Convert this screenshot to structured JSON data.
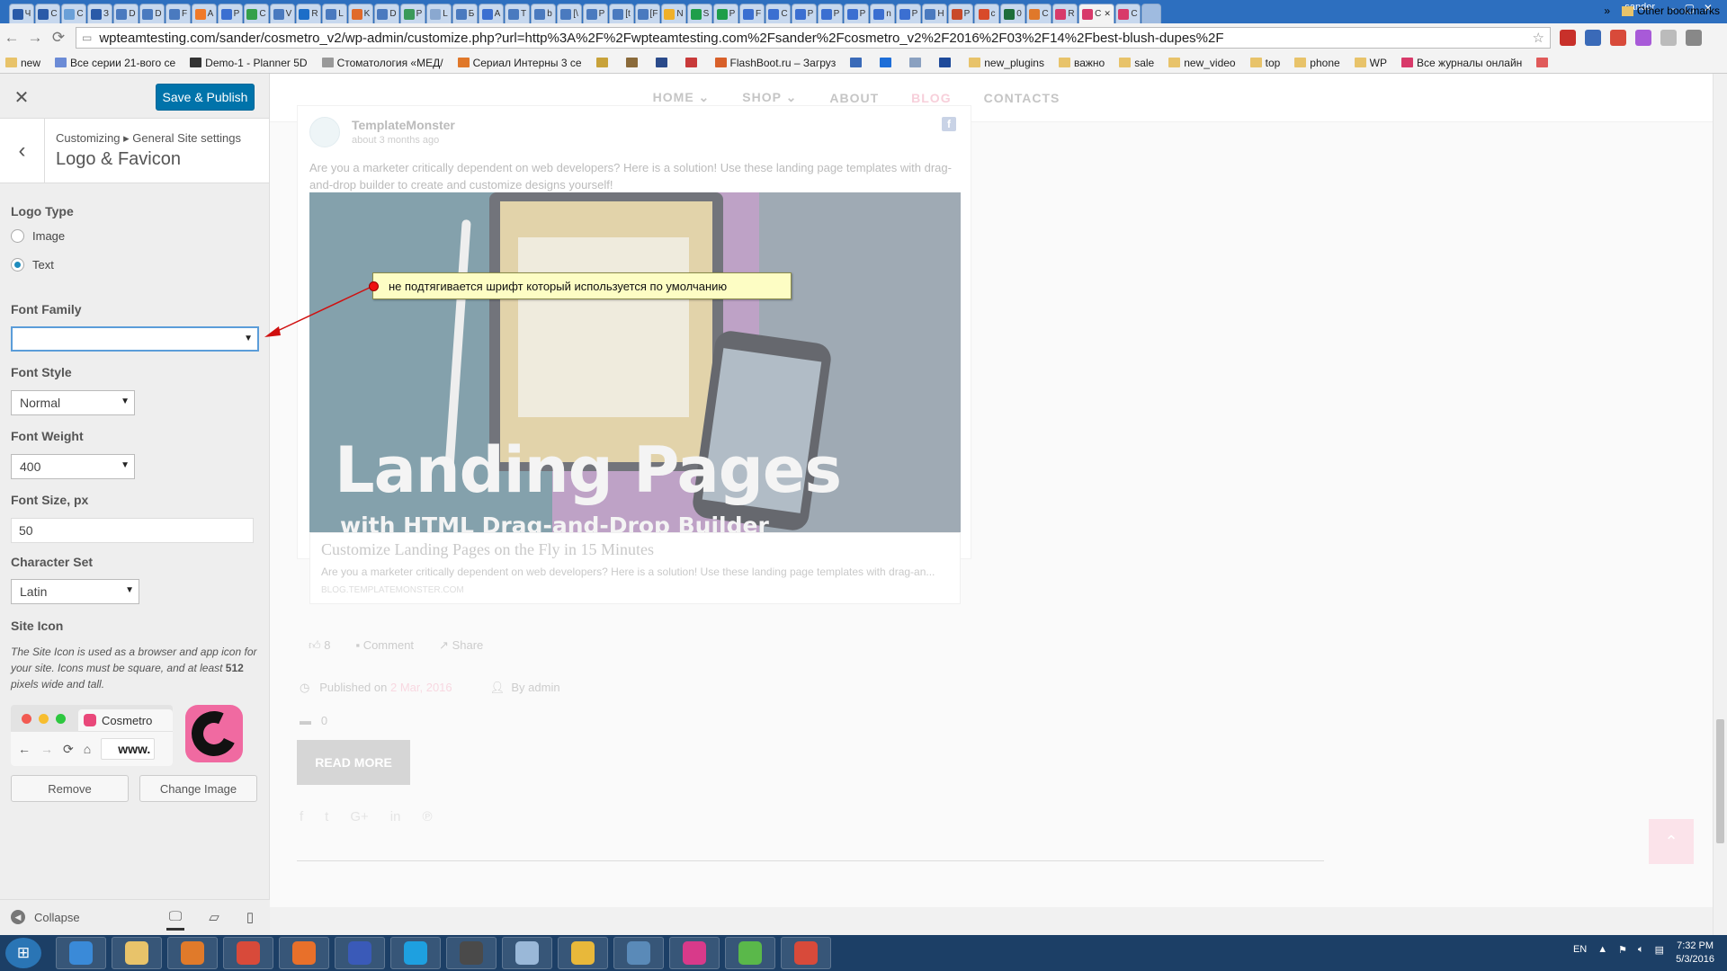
{
  "browser": {
    "tabs": [
      {
        "label": "Ч",
        "color": "#2a5aa8"
      },
      {
        "label": "С",
        "color": "#2a5aa8"
      },
      {
        "label": "С",
        "color": "#6aa0d8"
      },
      {
        "label": "З",
        "color": "#2a5aa8"
      },
      {
        "label": "D",
        "color": "#4a7abf"
      },
      {
        "label": "D",
        "color": "#4a7abf"
      },
      {
        "label": "F",
        "color": "#4a7abf"
      },
      {
        "label": "A",
        "color": "#f07a2a"
      },
      {
        "label": "P",
        "color": "#3b6fd1"
      },
      {
        "label": "C",
        "color": "#35a04a"
      },
      {
        "label": "V",
        "color": "#4a7abf"
      },
      {
        "label": "R",
        "color": "#1c6ec8"
      },
      {
        "label": "L",
        "color": "#4a7abf"
      },
      {
        "label": "K",
        "color": "#e06a2a"
      },
      {
        "label": "D",
        "color": "#4a7abf"
      },
      {
        "label": "P",
        "color": "#3a9a5a"
      },
      {
        "label": "L",
        "color": "#8aa8d0"
      },
      {
        "label": "Б",
        "color": "#4a7abf"
      },
      {
        "label": "A",
        "color": "#3b6fd1"
      },
      {
        "label": "T",
        "color": "#4a7abf"
      },
      {
        "label": "b",
        "color": "#4a7abf"
      },
      {
        "label": "[\\",
        "color": "#4a7abf"
      },
      {
        "label": "P",
        "color": "#4a7abf"
      },
      {
        "label": "[t",
        "color": "#4a7abf"
      },
      {
        "label": "[F",
        "color": "#4a7abf"
      },
      {
        "label": "N",
        "color": "#f0b02a"
      },
      {
        "label": "S",
        "color": "#1e9e4a"
      },
      {
        "label": "P",
        "color": "#1e9e4a"
      },
      {
        "label": "F",
        "color": "#3b6fd1"
      },
      {
        "label": "C",
        "color": "#3b6fd1"
      },
      {
        "label": "P",
        "color": "#3b6fd1"
      },
      {
        "label": "P",
        "color": "#3b6fd1"
      },
      {
        "label": "P",
        "color": "#3b6fd1"
      },
      {
        "label": "n",
        "color": "#3b6fd1"
      },
      {
        "label": "P",
        "color": "#3b6fd1"
      },
      {
        "label": "H",
        "color": "#4a7abf"
      },
      {
        "label": "P",
        "color": "#c84a2a"
      },
      {
        "label": "c",
        "color": "#d84a2a"
      },
      {
        "label": "0",
        "color": "#1e6e3a"
      },
      {
        "label": "C",
        "color": "#e0782a"
      },
      {
        "label": "R",
        "color": "#d83a6a"
      },
      {
        "label": "C",
        "color": "#d83a6a",
        "active": true
      },
      {
        "label": "C",
        "color": "#d83a6a"
      }
    ],
    "user": "sander",
    "url": "wpteamtesting.com/sander/cosmetro_v2/wp-admin/customize.php?url=http%3A%2F%2Fwpteamtesting.com%2Fsander%2Fcosmetro_v2%2F2016%2F03%2F14%2Fbest-blush-dupes%2F",
    "bookmarks": [
      {
        "label": "new",
        "type": "folder"
      },
      {
        "label": "Все серии 21-вого се",
        "type": "site",
        "color": "#6b8bd6"
      },
      {
        "label": "Demo-1 - Planner 5D",
        "type": "site",
        "color": "#333333"
      },
      {
        "label": "Стоматология «МЕД/",
        "type": "site",
        "color": "#999999"
      },
      {
        "label": "Сериал Интерны 3 се",
        "type": "site",
        "color": "#e0782a"
      },
      {
        "label": "",
        "type": "site",
        "color": "#c8a23a"
      },
      {
        "label": "",
        "type": "site",
        "color": "#8a6a3a"
      },
      {
        "label": "",
        "type": "site",
        "color": "#2a4a8a"
      },
      {
        "label": "",
        "type": "site",
        "color": "#c83a3a"
      },
      {
        "label": "FlashBoot.ru – Загруз",
        "type": "site",
        "color": "#d8602a"
      },
      {
        "label": "",
        "type": "site",
        "color": "#3a6ab8"
      },
      {
        "label": "",
        "type": "site",
        "color": "#1e6ed8"
      },
      {
        "label": "",
        "type": "site",
        "color": "#8aa0c0"
      },
      {
        "label": "",
        "type": "site",
        "color": "#1e4a9a"
      },
      {
        "label": "new_plugins",
        "type": "folder"
      },
      {
        "label": "важно",
        "type": "folder"
      },
      {
        "label": "sale",
        "type": "folder"
      },
      {
        "label": "new_video",
        "type": "folder"
      },
      {
        "label": "top",
        "type": "folder"
      },
      {
        "label": "phone",
        "type": "folder"
      },
      {
        "label": "WP",
        "type": "folder"
      },
      {
        "label": "Все журналы онлайн",
        "type": "site",
        "color": "#d83a6a"
      },
      {
        "label": "",
        "type": "site",
        "color": "#e05a5a"
      }
    ],
    "bookmarks_more": "»",
    "other_bookmarks": "Other bookmarks"
  },
  "customizer": {
    "close_glyph": "✕",
    "save_label": "Save & Publish",
    "back_glyph": "‹",
    "breadcrumb": "Customizing ▸ General Site settings",
    "section_title": "Logo & Favicon",
    "logo_type_label": "Logo Type",
    "logo_type_options": [
      {
        "label": "Image",
        "selected": false
      },
      {
        "label": "Text",
        "selected": true
      }
    ],
    "font_family_label": "Font Family",
    "font_family_value": "",
    "font_style_label": "Font Style",
    "font_style_value": "Normal",
    "font_weight_label": "Font Weight",
    "font_weight_value": "400",
    "font_size_label": "Font Size, px",
    "font_size_value": "50",
    "charset_label": "Character Set",
    "charset_value": "Latin",
    "site_icon_label": "Site Icon",
    "site_icon_desc_1": "The Site Icon is used as a browser and app icon for your site. Icons must be square, and at least ",
    "site_icon_desc_bold": "512",
    "site_icon_desc_2": " pixels wide and tall.",
    "preview_tab_title": "Cosmetro",
    "preview_url": "www.",
    "remove_label": "Remove",
    "change_image_label": "Change Image",
    "collapse_label": "Collapse",
    "select_arrow": "▼"
  },
  "annotation": {
    "text": "не подтягивается шрифт который используется по умолчанию"
  },
  "site": {
    "nav": [
      {
        "label": "HOME",
        "caret": true
      },
      {
        "label": "SHOP",
        "caret": true
      },
      {
        "label": "ABOUT",
        "caret": false
      },
      {
        "label": "BLOG",
        "caret": false,
        "active": true
      },
      {
        "label": "CONTACTS",
        "caret": false
      }
    ],
    "post": {
      "author": "TemplateMonster",
      "date": "about 3 months ago",
      "intro": "Are you a marketer critically dependent on web developers? Here is a solution! Use these landing page templates with drag-and-drop builder to create and customize designs yourself!",
      "image_title": "Landing Pages",
      "image_subtitle": "with HTML Drag-and-Drop Builder",
      "link_title": "Customize Landing Pages on the Fly in 15 Minutes",
      "link_desc": "Are you a marketer critically dependent on web developers? Here is a solution! Use these landing page templates with drag-an...",
      "link_domain": "BLOG.TEMPLATEMONSTER.COM",
      "likes": "8",
      "comment_label": "Comment",
      "share_label": "Share",
      "published_prefix": "Published on",
      "published_date": "2 Mar, 2016",
      "by_label": "By admin",
      "comments_count": "0",
      "read_more": "READ MORE"
    }
  },
  "taskbar": {
    "lang": "EN",
    "time": "7:32 PM",
    "date": "5/3/2016",
    "apps": [
      {
        "name": "ie",
        "color": "#3a8ad8"
      },
      {
        "name": "explorer",
        "color": "#e8c36a"
      },
      {
        "name": "media",
        "color": "#e07a2a"
      },
      {
        "name": "chrome",
        "color": "#d84a3a"
      },
      {
        "name": "firefox",
        "color": "#e8702a"
      },
      {
        "name": "save",
        "color": "#3a5ab8"
      },
      {
        "name": "skype",
        "color": "#1ea0e0"
      },
      {
        "name": "sublime",
        "color": "#4a4a4a"
      },
      {
        "name": "notes",
        "color": "#9ab8d8"
      },
      {
        "name": "app",
        "color": "#e8b83a"
      },
      {
        "name": "screens",
        "color": "#5a8ab8"
      },
      {
        "name": "s-app",
        "color": "#d83a8a"
      },
      {
        "name": "green-app",
        "color": "#5ab84a"
      },
      {
        "name": "chrome-2",
        "color": "#d84a3a"
      }
    ]
  }
}
